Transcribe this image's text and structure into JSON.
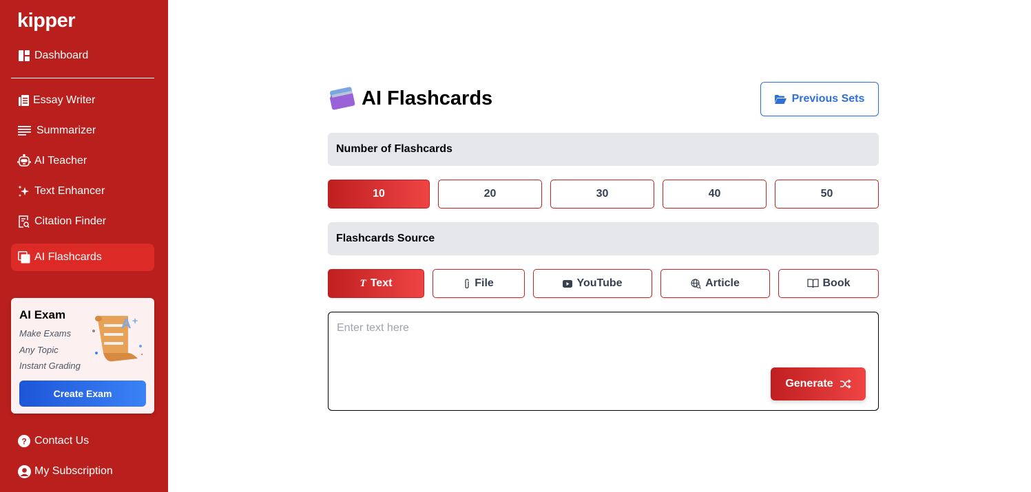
{
  "sidebar": {
    "logo": "kipper",
    "items": [
      {
        "label": "Dashboard",
        "icon": "dashboard-icon"
      },
      {
        "label": "Essay Writer",
        "icon": "document-icon"
      },
      {
        "label": "Summarizer",
        "icon": "text-lines-icon"
      },
      {
        "label": "AI Teacher",
        "icon": "robot-icon"
      },
      {
        "label": "Text Enhancer",
        "icon": "sparkles-icon"
      },
      {
        "label": "Citation Finder",
        "icon": "document-search-icon"
      },
      {
        "label": "AI Flashcards",
        "icon": "cards-icon",
        "active": true
      }
    ],
    "promo": {
      "title": "AI Exam",
      "lines": [
        "Make Exams",
        "Any Topic",
        "Instant Grading"
      ],
      "button": "Create Exam"
    },
    "footer": [
      {
        "label": "Contact Us",
        "icon": "question-circle-icon"
      },
      {
        "label": "My Subscription",
        "icon": "user-circle-icon"
      }
    ]
  },
  "main": {
    "title": "AI Flashcards",
    "previous_sets": "Previous Sets",
    "count_section": {
      "label": "Number of Flashcards",
      "options": [
        "10",
        "20",
        "30",
        "40",
        "50"
      ],
      "selected": "10"
    },
    "source_section": {
      "label": "Flashcards Source",
      "options": [
        {
          "label": "Text",
          "icon": "text-italic-icon"
        },
        {
          "label": "File",
          "icon": "paperclip-icon"
        },
        {
          "label": "YouTube",
          "icon": "youtube-icon"
        },
        {
          "label": "Article",
          "icon": "globe-search-icon"
        },
        {
          "label": "Book",
          "icon": "book-icon"
        }
      ],
      "selected": "Text"
    },
    "input": {
      "placeholder": "Enter text here",
      "value": ""
    },
    "generate": "Generate"
  },
  "colors": {
    "sidebar_bg": "#b91f1c",
    "active_item": "#dc2a26",
    "accent_red": "#ef4444",
    "accent_blue": "#2f6fdc"
  }
}
